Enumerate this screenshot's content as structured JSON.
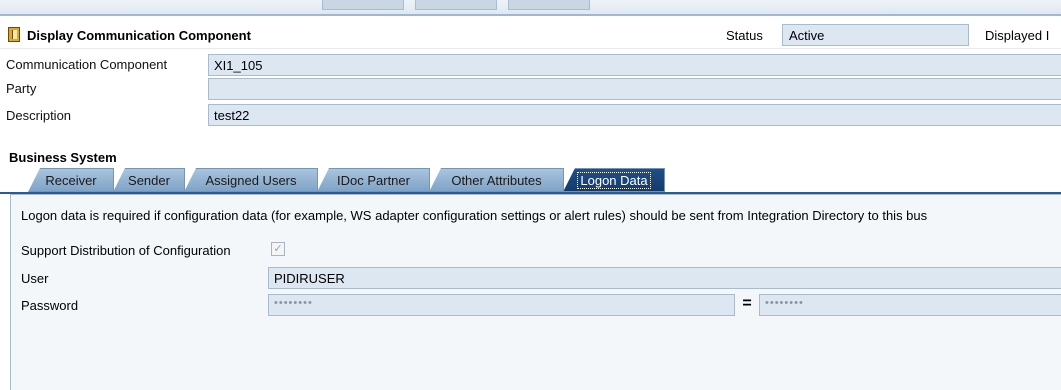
{
  "header": {
    "title": "Display Communication Component",
    "status_label": "Status",
    "status_value": "Active",
    "displayed_label": "Displayed I"
  },
  "fields": {
    "communication_component": {
      "label": "Communication Component",
      "value": "XI1_105"
    },
    "party": {
      "label": "Party",
      "value": ""
    },
    "description": {
      "label": "Description",
      "value": "test22"
    }
  },
  "section": {
    "title": "Business System"
  },
  "tabs": [
    {
      "label": "Receiver",
      "active": false
    },
    {
      "label": "Sender",
      "active": false
    },
    {
      "label": "Assigned Users",
      "active": false
    },
    {
      "label": "IDoc Partner",
      "active": false
    },
    {
      "label": "Other Attributes",
      "active": false
    },
    {
      "label": "Logon Data",
      "active": true
    }
  ],
  "logon": {
    "info_text": "Logon data is required if configuration data (for example, WS adapter configuration settings or alert rules) should be sent from Integration Directory to this bus",
    "support_label": "Support Distribution of Configuration",
    "support_checked": true,
    "user_label": "User",
    "user_value": "PIDIRUSER",
    "password_label": "Password",
    "password_mask": "••••••••",
    "password_confirm_mask": "••••••••",
    "equals_symbol": "="
  },
  "colors": {
    "field_bg": "#dce7f2",
    "tab_bg": "#a9c4de",
    "tab_active_bg": "#1f4f8a"
  }
}
